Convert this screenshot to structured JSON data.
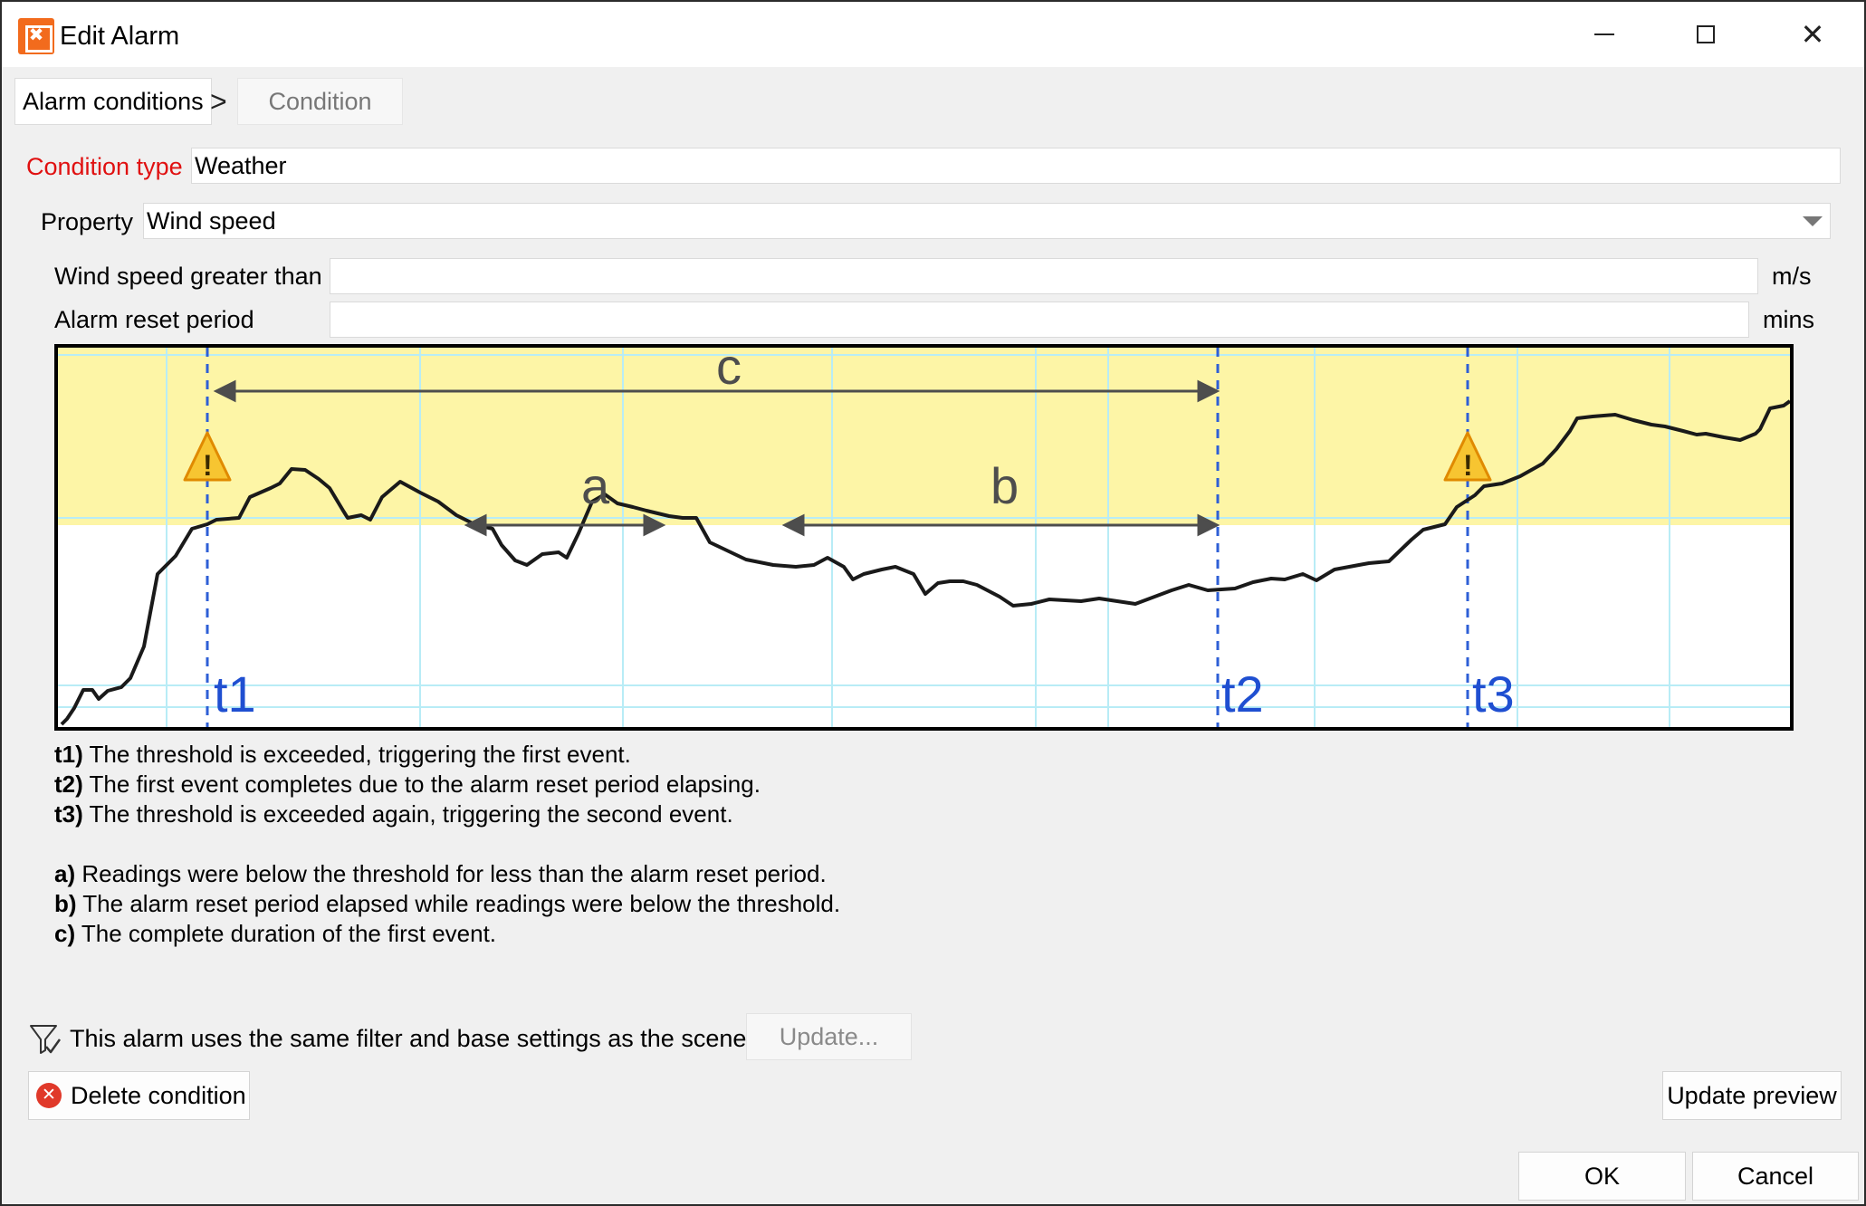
{
  "window": {
    "title": "Edit Alarm",
    "minimize_glyph": "",
    "close_glyph": "✕"
  },
  "breadcrumb": {
    "items": [
      {
        "label": "Alarm conditions",
        "active": true
      },
      {
        "label": "Condition",
        "active": false
      }
    ],
    "separator": ">"
  },
  "form": {
    "condition_type_label": "Condition type",
    "condition_type_value": "Weather",
    "property_label": "Property",
    "property_value": "Wind speed",
    "threshold_label": "Wind speed greater than",
    "threshold_value": "",
    "threshold_unit": "m/s",
    "reset_label": "Alarm reset period",
    "reset_value": "",
    "reset_unit": "mins"
  },
  "diagram": {
    "labels": {
      "a": "a",
      "b": "b",
      "c": "c",
      "t1": "t1",
      "t2": "t2",
      "t3": "t3"
    },
    "warning_glyph": "!",
    "colors": {
      "threshold_zone": "#fdf5a6",
      "reading_line": "#1a1a1a",
      "marker_line": "#2e5fd6",
      "marker_text": "#1f4fd1",
      "arrow": "#4d4d4d",
      "grid": "#b8ecf6",
      "warning_fill": "#f7c531",
      "warning_stroke": "#e08a00"
    }
  },
  "legend": {
    "times": [
      {
        "key": "t1)",
        "text": " The threshold is exceeded, triggering the first event."
      },
      {
        "key": "t2)",
        "text": " The first event completes due to the alarm reset period elapsing."
      },
      {
        "key": "t3)",
        "text": " The threshold is exceeded again, triggering the second event."
      }
    ],
    "spans": [
      {
        "key": "a)",
        "text": " Readings were below the threshold for less than the alarm reset period."
      },
      {
        "key": "b)",
        "text": " The alarm reset period elapsed while readings were below the threshold."
      },
      {
        "key": "c)",
        "text": " The complete duration of the first event."
      }
    ]
  },
  "footer": {
    "filter_text": "This alarm uses the same filter and base settings as the scene",
    "update_button": "Update...",
    "delete_button": "Delete condition",
    "update_preview_button": "Update preview",
    "ok_button": "OK",
    "cancel_button": "Cancel"
  }
}
